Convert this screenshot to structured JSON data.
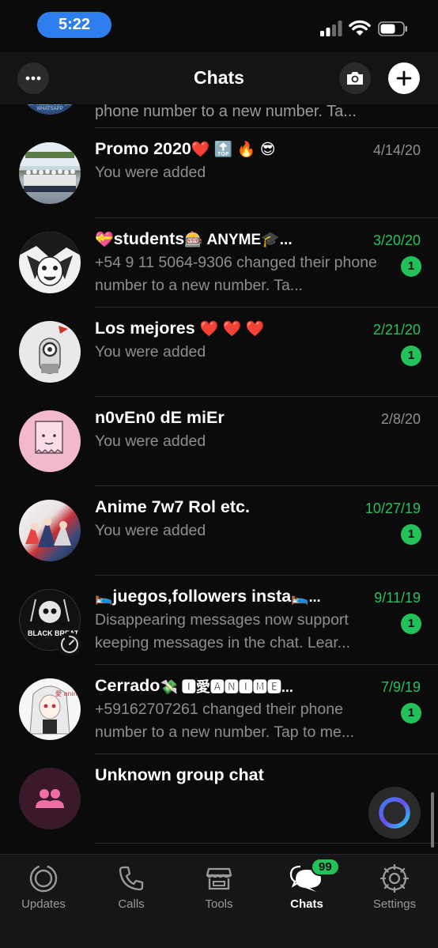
{
  "status_bar": {
    "time": "5:22"
  },
  "header": {
    "title": "Chats"
  },
  "partial_row": {
    "preview": "phone number to a new number. Ta...",
    "avatar_text": "EL MEJOR BOT DE WHATSAPP"
  },
  "chats": [
    {
      "name": "Promo 2020",
      "name_suffix": "❤️ 🔝 🔥 😎",
      "date": "4/14/20",
      "preview": "You were added",
      "unread": false,
      "badge": ""
    },
    {
      "name": "students",
      "name_prefix": "💝",
      "name_suffix": "🎰 ANYME🎓...",
      "date": "3/20/20",
      "preview": "+54 9 11 5064-9306 changed their phone number to a new number. Ta...",
      "unread": true,
      "badge": "1"
    },
    {
      "name": "Los mejores",
      "name_suffix": "❤️ ❤️ ❤️",
      "date": "2/21/20",
      "preview": "You were added",
      "unread": true,
      "badge": "1"
    },
    {
      "name": "n0vEn0 dE miEr",
      "date": "2/8/20",
      "preview": "You were added",
      "unread": false,
      "badge": ""
    },
    {
      "name": "Anime 7w7 Rol etc.",
      "date": "10/27/19",
      "preview": "You were added",
      "unread": true,
      "badge": "1"
    },
    {
      "name": "juegos,followers insta",
      "name_prefix": "🛌",
      "name_suffix": "🛌...",
      "date": "9/11/19",
      "preview": "Disappearing messages now support keeping messages in the chat. Lear...",
      "unread": true,
      "badge": "1",
      "avatar_text": "BLACK BREATH"
    },
    {
      "name": "Cerrado",
      "name_suffix": "💸 🅸愛🅰🅽🅸🅼🅴...",
      "date": "7/9/19",
      "preview": "+59162707261 changed their phone number to a new number. Tap to me...",
      "unread": true,
      "badge": "1",
      "avatar_text": "愛 anime"
    },
    {
      "name": "Unknown group chat",
      "date": "",
      "preview": "",
      "unread": false,
      "badge": ""
    }
  ],
  "tabs": [
    {
      "label": "Updates",
      "icon": "updates-icon",
      "active": false
    },
    {
      "label": "Calls",
      "icon": "phone-icon",
      "active": false
    },
    {
      "label": "Tools",
      "icon": "store-icon",
      "active": false
    },
    {
      "label": "Chats",
      "icon": "chats-icon",
      "active": true,
      "badge": "99"
    },
    {
      "label": "Settings",
      "icon": "gear-icon",
      "active": false
    }
  ],
  "colors": {
    "accent_green": "#23c15a",
    "time_pill": "#2f7ef0",
    "background": "#0b0b0b"
  }
}
